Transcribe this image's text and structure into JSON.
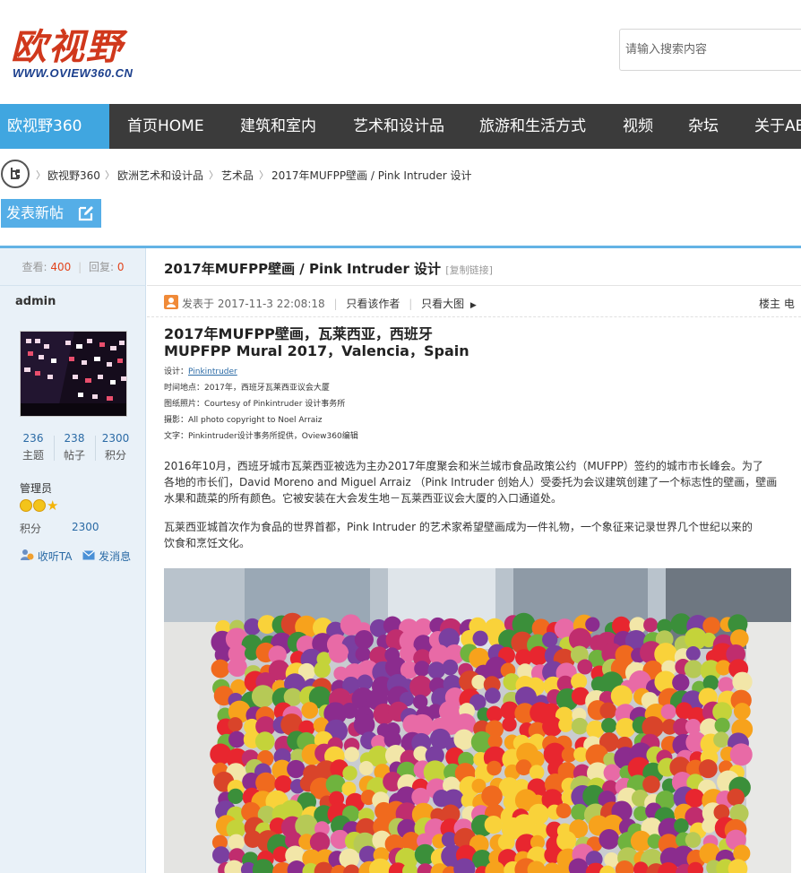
{
  "site": {
    "logo_text": "欧视野",
    "logo_url": "WWW.OVIEW360.CN",
    "search_placeholder": "请输入搜索内容"
  },
  "nav": [
    {
      "label": "欧视野360",
      "active": true
    },
    {
      "label": "首页HOME"
    },
    {
      "label": "建筑和室内"
    },
    {
      "label": "艺术和设计品"
    },
    {
      "label": "旅游和生活方式"
    },
    {
      "label": "视频"
    },
    {
      "label": "杂坛"
    },
    {
      "label": "关于AB"
    }
  ],
  "breadcrumb": [
    "欧视野360",
    "欧洲艺术和设计品",
    "艺术品",
    "2017年MUFPP壁画 / Pink Intruder 设计"
  ],
  "post_button": "发表新帖",
  "sidebar": {
    "views_label": "查看:",
    "views": "400",
    "replies_label": "回复:",
    "replies": "0",
    "author": "admin",
    "stats": [
      {
        "num": "236",
        "label": "主题"
      },
      {
        "num": "238",
        "label": "帖子"
      },
      {
        "num": "2300",
        "label": "积分"
      }
    ],
    "role": "管理员",
    "points_label": "积分",
    "points": "2300",
    "follow": "收听TA",
    "message": "发消息"
  },
  "thread": {
    "title": "2017年MUFPP壁画 / Pink Intruder 设计",
    "copy_link": "[复制链接]",
    "posted": "发表于 2017-11-3 22:08:18",
    "only_author": "只看该作者",
    "big_image": "只看大图",
    "floor": "楼主 电",
    "heading_cn": "2017年MUFPP壁画，瓦莱西亚，西班牙",
    "heading_en": "MUPFPP Mural 2017，Valencia，Spain",
    "design_label": "设计：",
    "design_link": "Pinkintruder",
    "credit_time": "时间地点：2017年，西班牙瓦莱西亚议会大厦",
    "credit_photo": "图纸照片：Courtesy of Pinkintruder 设计事务所",
    "credit_photog": "摄影：All photo copyright to Noel Arraiz",
    "credit_text": "文字：Pinkintruder设计事务所提供，Oview360编辑",
    "p1_l1": "2016年10月，西班牙城市瓦莱西亚被选为主办2017年度聚会和米兰城市食品政策公约（MUFPP）签约的城市市长峰会。为了",
    "p1_l2": "各地的市长们，David Moreno and Miguel Arraiz （Pink Intruder 创始人）受委托为会议建筑创建了一个标志性的壁画，壁画",
    "p1_l3": "水果和蔬菜的所有颜色。它被安装在大会发生地－瓦莱西亚议会大厦的入口通道处。",
    "p2_l1": "瓦莱西亚城首次作为食品的世界首都，Pink Intruder 的艺术家希望壁画成为一件礼物，一个象征来记录世界几个世纪以来的",
    "p2_l2": "饮食和烹饪文化。"
  },
  "colors": {
    "nav_bg": "#3b3b3b",
    "nav_active": "#40a6e0",
    "accent_blue": "#55aee7",
    "sidebar_bg": "#e9f1f8",
    "link": "#2a6aa5",
    "count_red": "#e2441c"
  }
}
